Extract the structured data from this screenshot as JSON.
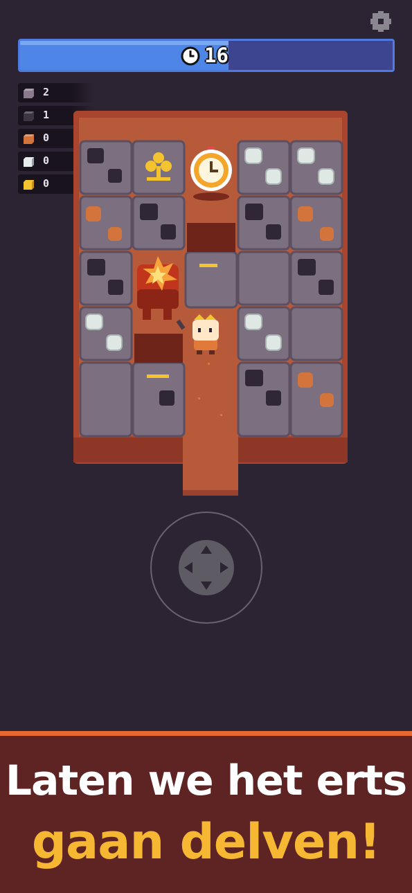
{
  "timer": {
    "value": "16",
    "remaining_fraction": 0.56,
    "icon": "clock-icon"
  },
  "settings": {
    "icon": "gear-icon"
  },
  "resources": [
    {
      "name": "stone",
      "icon": "stone-ore-icon",
      "count": "2",
      "color": "#8a7a8c"
    },
    {
      "name": "coal",
      "icon": "coal-ore-icon",
      "count": "1",
      "color": "#3e3442"
    },
    {
      "name": "copper",
      "icon": "copper-ore-icon",
      "count": "0",
      "color": "#d2743c"
    },
    {
      "name": "silver",
      "icon": "silver-ore-icon",
      "count": "0",
      "color": "#e6eceb"
    },
    {
      "name": "gold",
      "icon": "gold-ore-icon",
      "count": "0",
      "color": "#f4c430"
    }
  ],
  "banner": {
    "line1": "Laten we het erts",
    "line2": "gaan delven!"
  },
  "colors": {
    "background": "#2d2433",
    "timer_fill": "#4d86e6",
    "banner_bg": "#5e2323",
    "banner_accent": "#e66a2f",
    "headline_yellow": "#f6b833"
  }
}
